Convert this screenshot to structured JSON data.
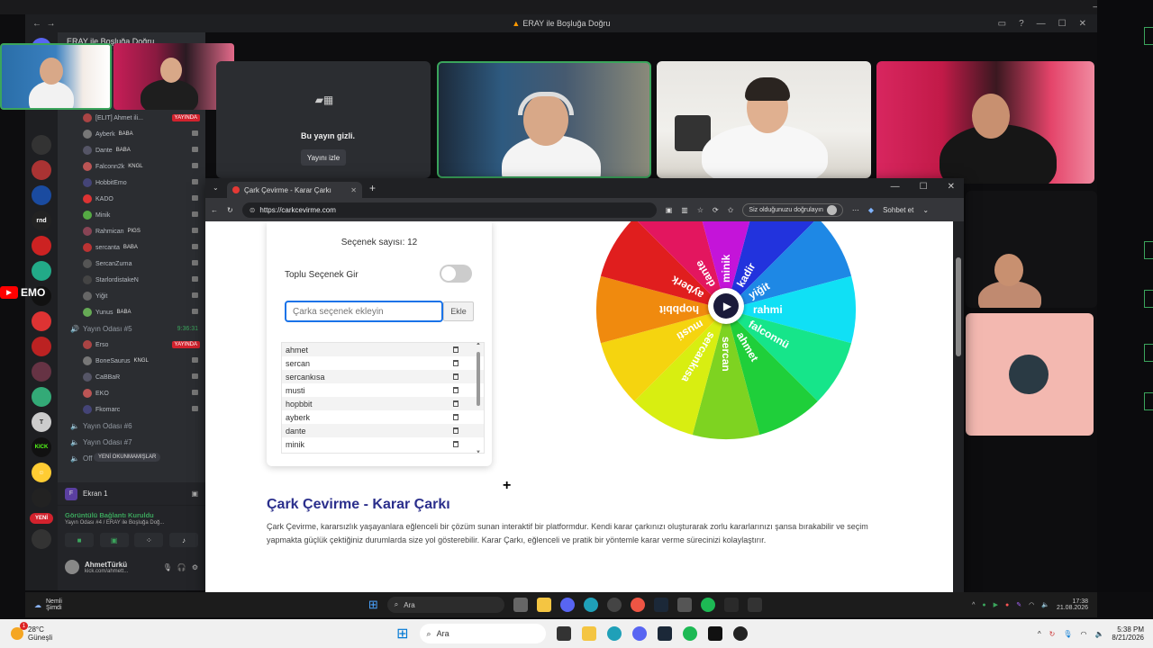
{
  "discord": {
    "window_title": "ERAY ile Boşluğa Doğru",
    "server_name": "ERAY ile Boşluğa Doğru",
    "server_icons": [
      "rnd",
      "KICK",
      "YENİ"
    ],
    "members": [
      {
        "name": "[ELIT] Ahmet ili...",
        "badge": "",
        "tag": "YAYINDA"
      },
      {
        "name": "Ayberk",
        "badge": "BABA",
        "tag": ""
      },
      {
        "name": "Dante",
        "badge": "BABA",
        "tag": ""
      },
      {
        "name": "Falconn2k",
        "badge": "KNGL",
        "tag": ""
      },
      {
        "name": "HobbitEmo",
        "badge": "",
        "tag": ""
      },
      {
        "name": "KADO",
        "badge": "",
        "tag": ""
      },
      {
        "name": "Minik",
        "badge": "",
        "tag": ""
      },
      {
        "name": "Rahmican",
        "badge": "PIGS",
        "tag": ""
      },
      {
        "name": "sercanta",
        "badge": "BABA",
        "tag": ""
      },
      {
        "name": "SercanZurna",
        "badge": "",
        "tag": ""
      },
      {
        "name": "StarlordistakeN",
        "badge": "",
        "tag": ""
      },
      {
        "name": "Yiğit",
        "badge": "",
        "tag": ""
      },
      {
        "name": "Yunus",
        "badge": "BABA",
        "tag": ""
      }
    ],
    "voice_channel_5": {
      "label": "Yayın Odası #5",
      "time": "9:36:31"
    },
    "members2": [
      {
        "name": "Erso",
        "tag": "YAYINDA",
        "badge": ""
      },
      {
        "name": "BoneSaurus",
        "tag": "",
        "badge": "KNGL"
      },
      {
        "name": "CaBBaR",
        "tag": "",
        "badge": ""
      },
      {
        "name": "EKO",
        "tag": "",
        "badge": ""
      },
      {
        "name": "Fkomarc",
        "tag": "",
        "badge": ""
      }
    ],
    "voice_channel_6": "Yayın Odası #6",
    "voice_channel_7": "Yayın Odası #7",
    "off_stream": "Off Stream #1",
    "unread_pill": "YENİ OKUNMAMIŞLAR",
    "stream_label": "Ekran 1",
    "connection_status": "Görüntülü Bağlantı Kuruldu",
    "connection_sub": "Yayın Odası #4 / ERAY ile Boşluğa Doğ...",
    "user_name": "AhmetTürkü",
    "user_status": "kick.com/ahmett...",
    "hidden_stream_text": "Bu yayın gizli.",
    "watch_stream_button": "Yayını izle",
    "yt_overlay": "EMO"
  },
  "browser": {
    "tab_title": "Çark Çevirme - Karar Çarkı",
    "url": "https://carkcevirme.com",
    "verify_text": "Siz olduğunuzu doğrulayın",
    "chat_label": "Sohbet et"
  },
  "page": {
    "option_count": "Seçenek sayısı: 12",
    "bulk_label": "Toplu Seçenek Gir",
    "input_placeholder": "Çarka seçenek ekleyin",
    "add_button": "Ekle",
    "options": [
      "ahmet",
      "sercan",
      "sercankısa",
      "musti",
      "hopbbit",
      "ayberk",
      "dante",
      "minik"
    ],
    "heading": "Çark Çevirme - Karar Çarkı",
    "description": "Çark Çevirme, kararsızlık yaşayanlara eğlenceli bir çözüm sunan interaktif bir platformdur. Kendi karar çarkınızı oluşturarak zorlu kararlarınızı şansa bırakabilir ve seçim yapmakta güçlük çektiğiniz durumlarda size yol gösterebilir. Karar Çarkı, eğlenceli ve pratik bir yöntemle karar verme sürecinizi kolaylaştırır.",
    "wheel_labels": [
      "kadir",
      "yiğit",
      "rahmi",
      "falconnü",
      "ahmet",
      "sercan",
      "sercankısa",
      "musti",
      "hopbbit",
      "ayberk",
      "dante",
      "minik"
    ],
    "wheel_colors": [
      "#2233dd",
      "#1e88e5",
      "#10e0f5",
      "#16e58a",
      "#1fcf3a",
      "#7ed321",
      "#d8ee11",
      "#f5d40f",
      "#f08a0e",
      "#e01e1e",
      "#e3165f",
      "#c414d9"
    ]
  },
  "taskbar_inner": {
    "weather_temp": "Nemli",
    "weather_sub": "Şimdi",
    "search": "Ara",
    "time": "17:38",
    "date": "21.08.2026"
  },
  "taskbar_outer": {
    "weather_temp": "28°C",
    "weather_sub": "Güneşli",
    "notif_count": "1",
    "search": "Ara",
    "time": "5:38 PM",
    "date": "8/21/2026"
  }
}
